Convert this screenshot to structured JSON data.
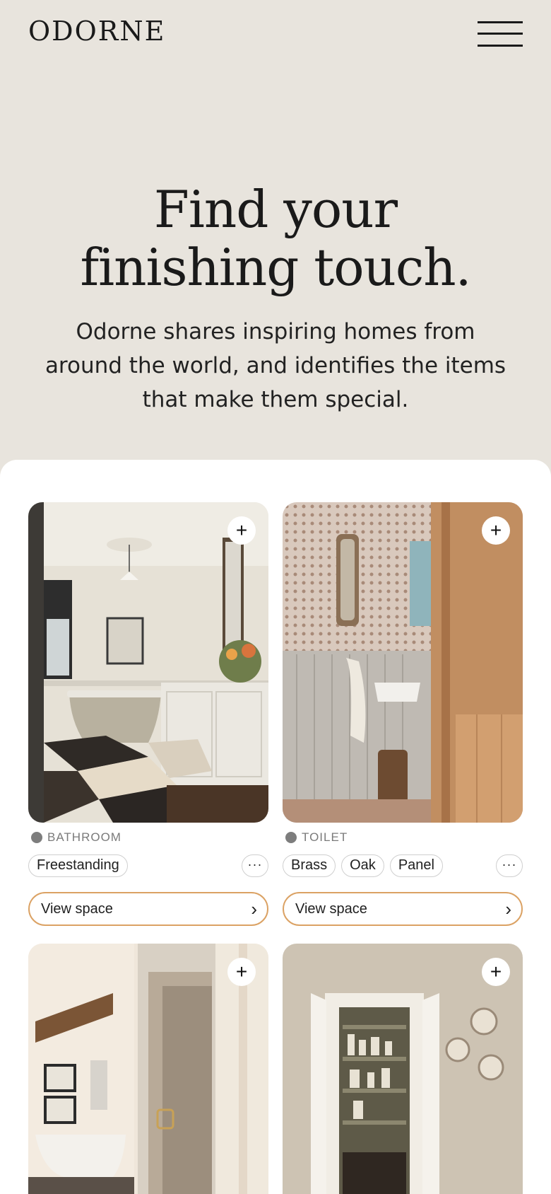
{
  "brand": {
    "logo": "ODORNE"
  },
  "hero": {
    "title": "Find your finishing touch.",
    "subtitle": "Odorne shares inspiring homes from around the world, and identifies the items that make them special."
  },
  "icons": {
    "menu": "hamburger-menu-icon",
    "add": "+",
    "more": "···",
    "chevron": "›"
  },
  "colors": {
    "background": "#e8e4dd",
    "accent": "#dba264",
    "panel": "#ffffff"
  },
  "cards": [
    {
      "category": "BATHROOM",
      "tags": [
        "Freestanding"
      ],
      "cta": "View space"
    },
    {
      "category": "TOILET",
      "tags": [
        "Brass",
        "Oak",
        "Panel"
      ],
      "cta": "View space"
    },
    {
      "category": "",
      "tags": [],
      "cta": ""
    },
    {
      "category": "",
      "tags": [],
      "cta": ""
    }
  ]
}
